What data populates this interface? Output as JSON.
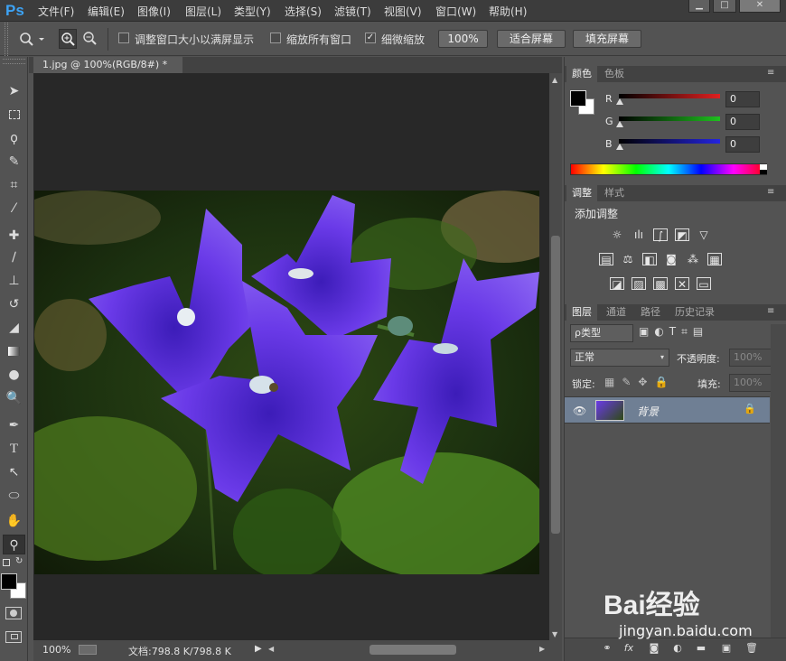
{
  "app": {
    "logo": "Ps"
  },
  "menu": [
    "文件(F)",
    "编辑(E)",
    "图像(I)",
    "图层(L)",
    "类型(Y)",
    "选择(S)",
    "滤镜(T)",
    "视图(V)",
    "窗口(W)",
    "帮助(H)"
  ],
  "window_controls": {
    "minimize": "▁",
    "maximize": "□",
    "close": "✕"
  },
  "options": {
    "resize_windows": {
      "label": "调整窗口大小以满屏显示",
      "checked": false
    },
    "zoom_all": {
      "label": "缩放所有窗口",
      "checked": false
    },
    "scrubby_zoom": {
      "label": "细微缩放",
      "checked": true,
      "mark": "✓"
    },
    "actual_pixels_btn": "100%",
    "fit_screen_btn": "适合屏幕",
    "fill_screen_btn": "填充屏幕"
  },
  "document": {
    "tab_title": "1.jpg @ 100%(RGB/8#) *",
    "tab_close": "×"
  },
  "status": {
    "zoom": "100%",
    "doc_info": "文档:798.8 K/798.8 K",
    "arrow": "▶"
  },
  "color_panel": {
    "tabs": [
      "颜色",
      "色板"
    ],
    "channels": [
      {
        "label": "R",
        "value": "0",
        "color": "#e02020"
      },
      {
        "label": "G",
        "value": "0",
        "color": "#1fc01f"
      },
      {
        "label": "B",
        "value": "0",
        "color": "#2424e0"
      }
    ]
  },
  "adjustments_panel": {
    "tabs": [
      "调整",
      "样式"
    ],
    "title": "添加调整"
  },
  "layers_panel": {
    "tabs": [
      "图层",
      "通道",
      "路径",
      "历史记录"
    ],
    "filter_kind": "ρ类型",
    "blend_mode": "正常",
    "opacity_label": "不透明度:",
    "opacity_value": "100%",
    "lock_label": "锁定:",
    "fill_label": "填充:",
    "fill_value": "100%",
    "layers": [
      {
        "name": "背景",
        "visible": true,
        "locked": true
      }
    ]
  },
  "watermark": {
    "brand": "Bai经验",
    "url": "jingyan.baidu.com"
  }
}
